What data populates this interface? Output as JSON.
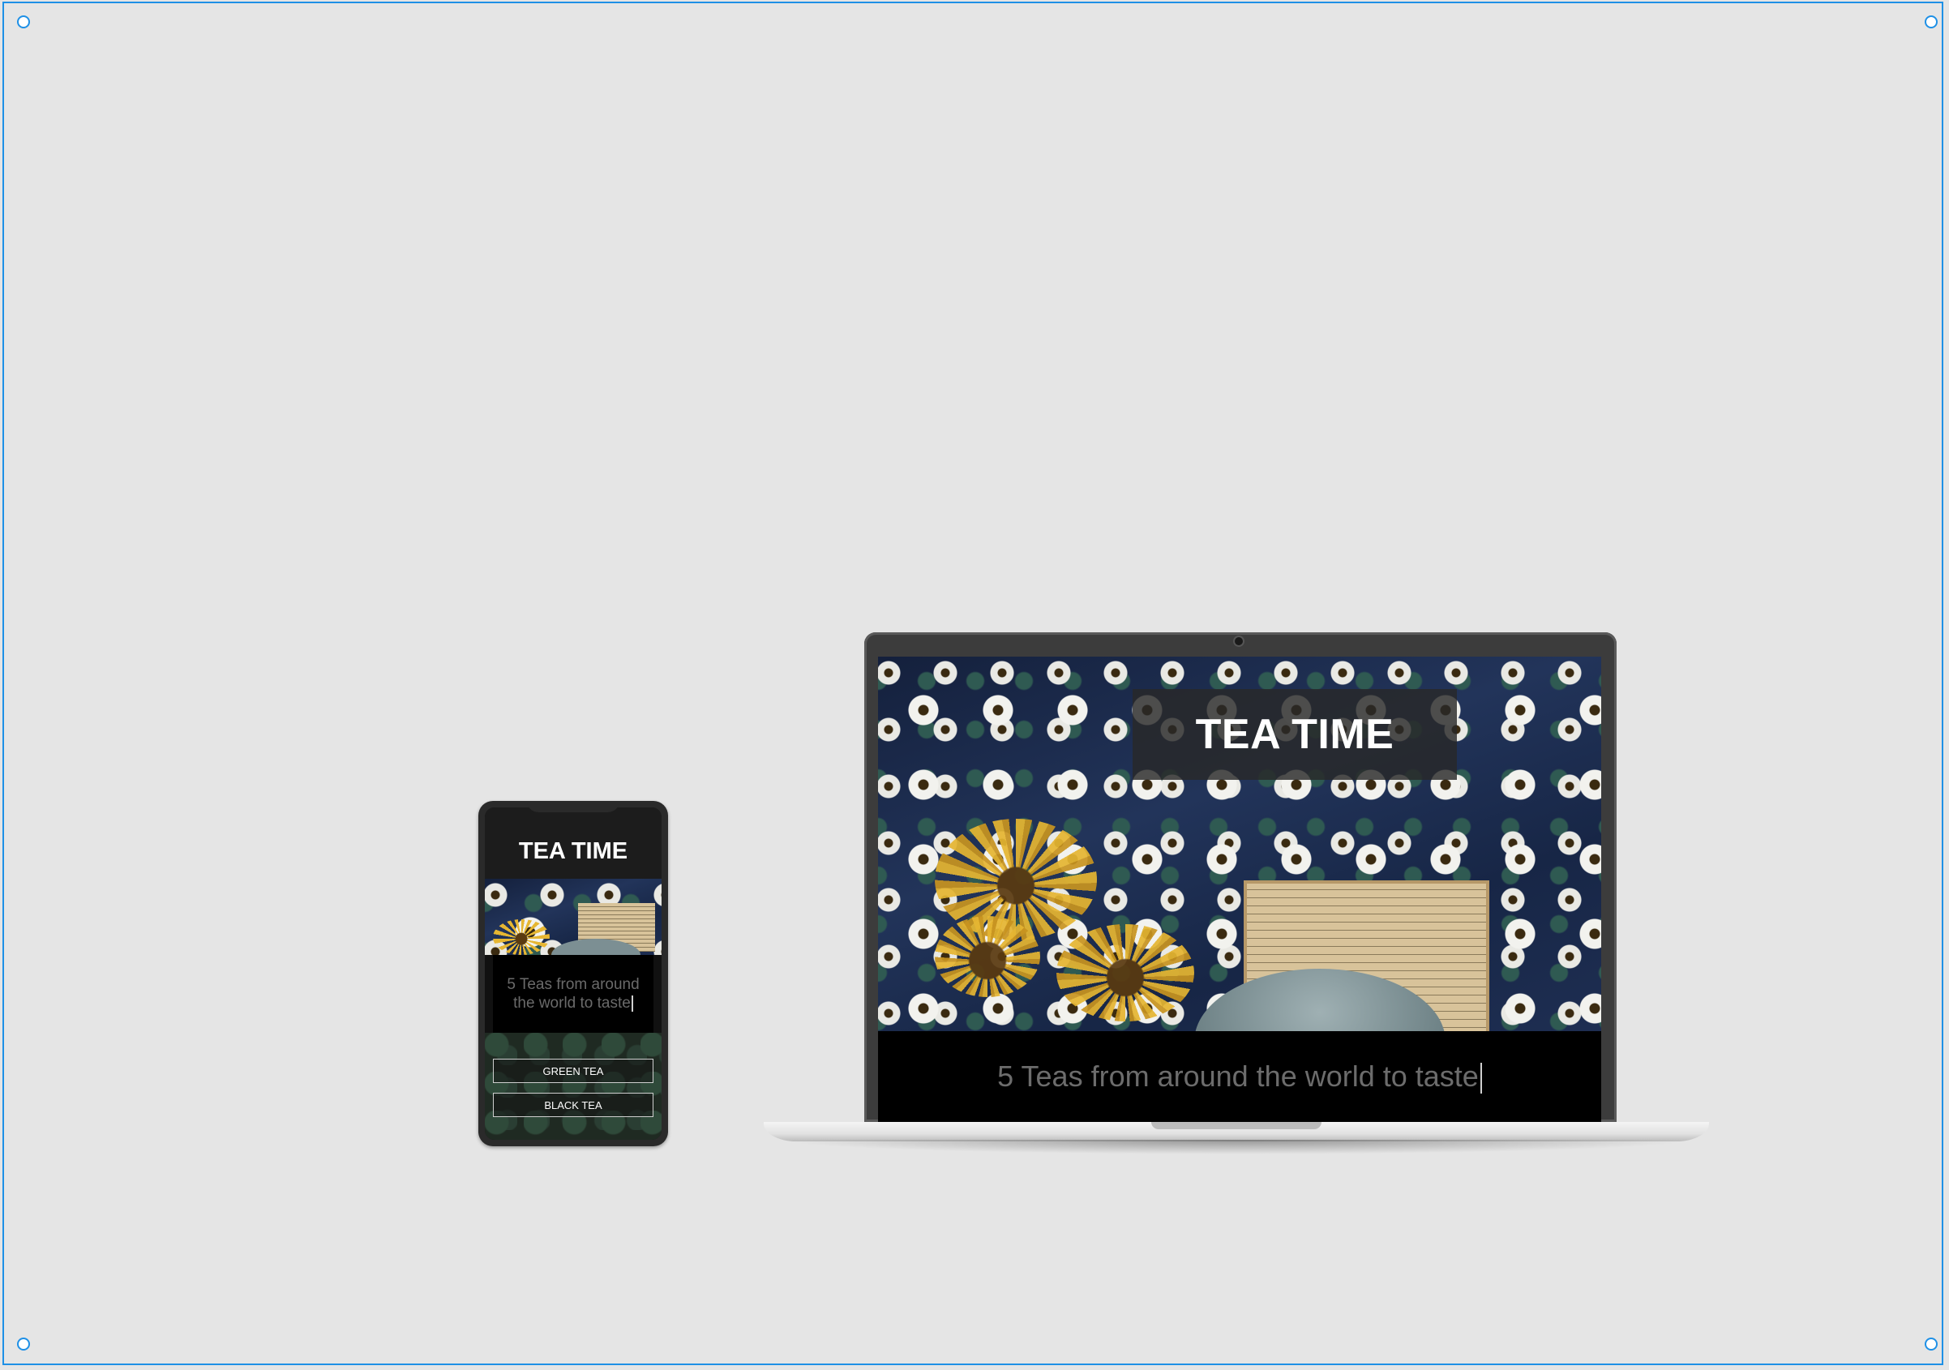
{
  "site": {
    "title": "TEA TIME",
    "tagline": "5 Teas from around the world to taste"
  },
  "phone": {
    "title": "TEA TIME",
    "tagline": "5 Teas from around the world to taste",
    "menu": [
      {
        "label": "GREEN TEA"
      },
      {
        "label": "BLACK TEA"
      }
    ]
  },
  "colors": {
    "selection": "#1e90e6",
    "background": "#e5e5e5",
    "tagline_text": "#6c6c6c"
  },
  "icons": {
    "handles": "circle-handle-icon",
    "caret": "text-caret-icon"
  }
}
